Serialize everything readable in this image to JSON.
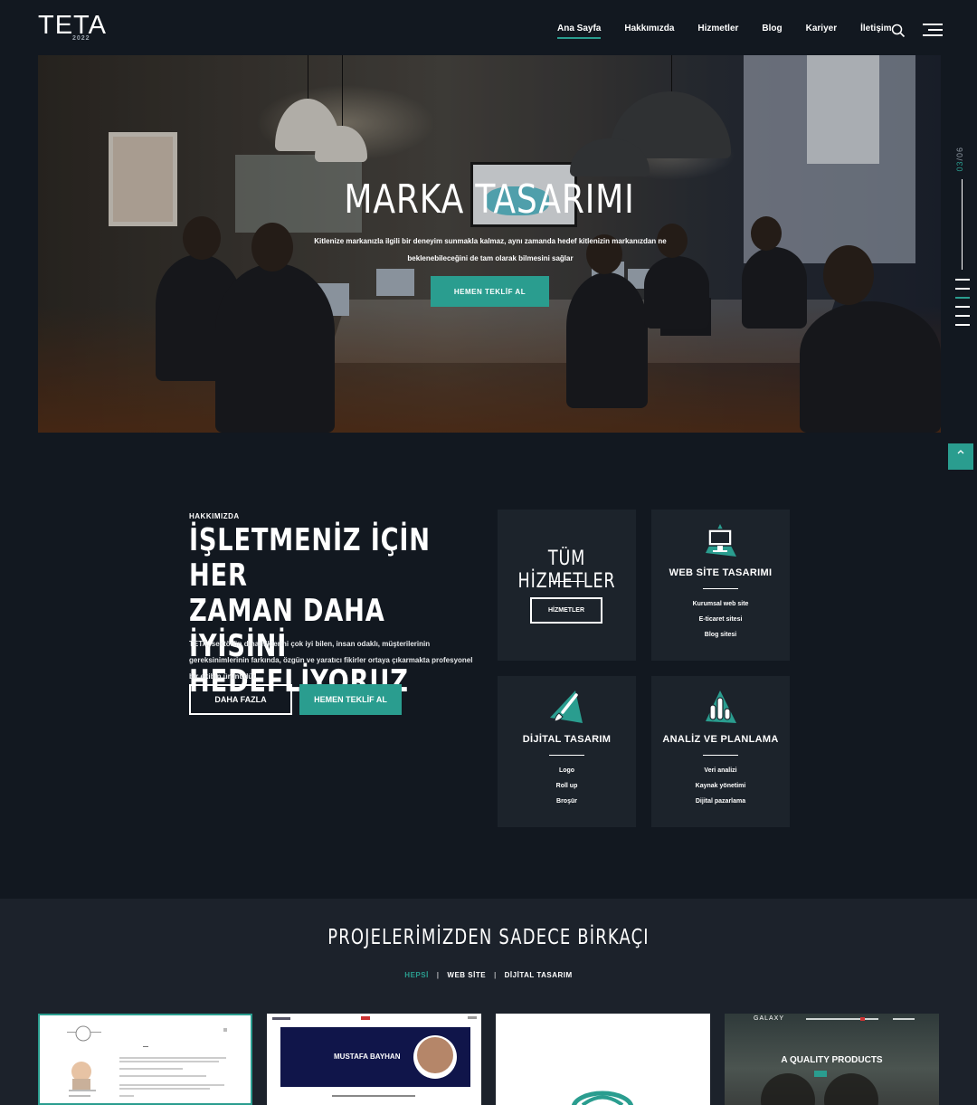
{
  "brand": {
    "name": "TETA",
    "year": "2022"
  },
  "nav": {
    "items": [
      {
        "label": "Ana Sayfa",
        "active": true
      },
      {
        "label": "Hakkımızda"
      },
      {
        "label": "Hizmetler"
      },
      {
        "label": "Blog"
      },
      {
        "label": "Kariyer"
      },
      {
        "label": "İletişim"
      }
    ],
    "search_icon": "search-icon",
    "menu_icon": "hamburger-menu-icon"
  },
  "hero": {
    "title": "MARKA TASARIMI",
    "subtitle": "Kitlenize markanızla ilgili bir deneyim sunmakla kalmaz, aynı zamanda hedef kitlenizin markanızdan ne beklenebileceğini de tam olarak bilmesini sağlar",
    "cta": "HEMEN TEKLİF AL",
    "slide_current": "03",
    "slide_total": "/06"
  },
  "scroll_top_icon": "chevron-up-icon",
  "about": {
    "eyebrow": "HAKKIMIZDA",
    "title_line1": "İŞLETMENİZ İÇİN HER",
    "title_line2": "ZAMAN DAHA İYİSİNİ",
    "title_line3": "HEDEFLİYORUZ",
    "text": "TETA, sektörün dinamiklerini çok iyi bilen, insan odaklı, müşterilerinin gereksinimlerinin farkında, özgün ve yaratıcı fikirler ortaya çıkarmakta profesyonel bir ekibin ürünüdür.",
    "more_label": "DAHA FAZLA",
    "offer_label": "HEMEN TEKLİF AL"
  },
  "services": {
    "all": {
      "title": "TÜM HİZMETLER",
      "button": "HİZMETLER"
    },
    "web": {
      "title": "WEB SİTE TASARIMI",
      "icon": "monitor-icon",
      "items": [
        "Kurumsal web site",
        "E-ticaret sitesi",
        "Blog sitesi"
      ]
    },
    "digital": {
      "title": "DİJİTAL TASARIM",
      "icon": "paintbrush-icon",
      "items": [
        "Logo",
        "Roll up",
        "Broşür"
      ]
    },
    "analysis": {
      "title": "ANALİZ VE PLANLAMA",
      "icon": "bar-chart-icon",
      "items": [
        "Veri analizi",
        "Kaynak yönetimi",
        "Dijital pazarlama"
      ]
    }
  },
  "projects": {
    "title": "PROJELERİMİZDEN SADECE BİRKAÇI",
    "filters": [
      "HEPSİ",
      "WEB SİTE",
      "DİJİTAL TASARIM"
    ],
    "thumb2_name": "MUSTAFA BAYHAN",
    "thumb4_brand": "GALAXY",
    "thumb4_heading": "A QUALITY PRODUCTS"
  },
  "colors": {
    "accent": "#2a9d8f",
    "background": "#121820",
    "card": "#1c232b"
  }
}
